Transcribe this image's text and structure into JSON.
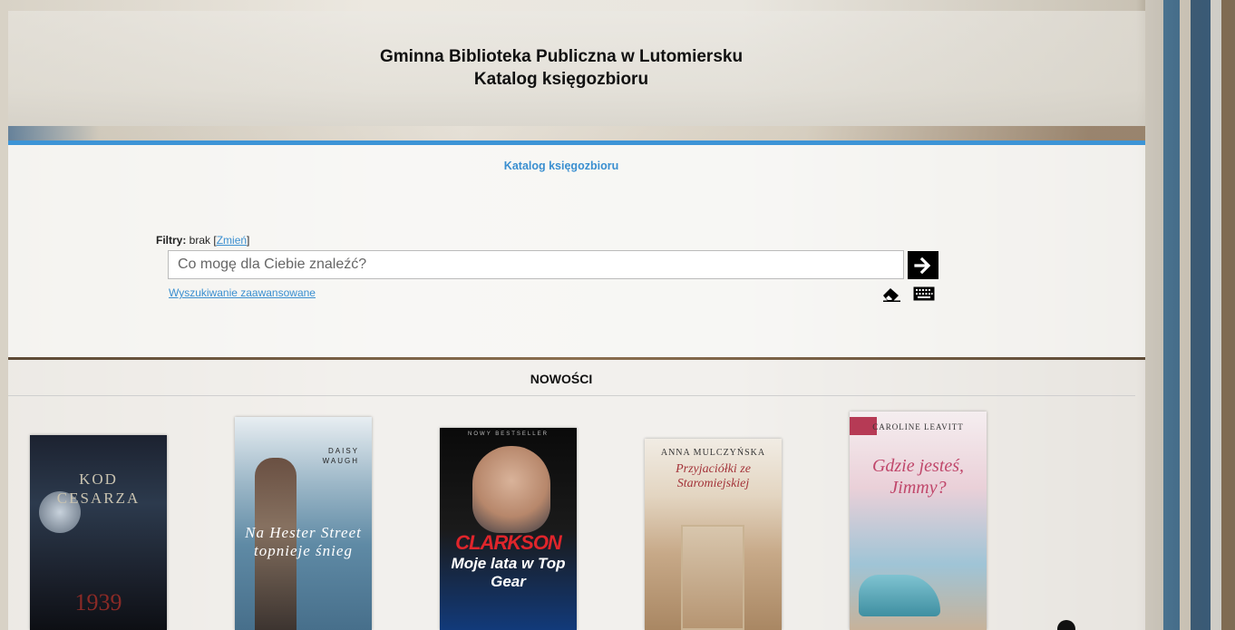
{
  "header": {
    "title_line1": "Gminna Biblioteka Publiczna w Lutomiersku",
    "title_line2": "Katalog księgozbioru"
  },
  "breadcrumb": "Katalog księgozbioru",
  "search": {
    "filters_label": "Filtry:",
    "filters_value": " brak ",
    "filters_change": "Zmień",
    "placeholder": "Co mogę dla Ciebie znaleźć?",
    "advanced_link": "Wyszukiwanie zaawansowane"
  },
  "news": {
    "heading": "NOWOŚCI",
    "books": [
      {
        "title_line1": "KOD",
        "title_line2": "CESARZA",
        "number": "1939"
      },
      {
        "author_line1": "DAISY",
        "author_line2": "WAUGH",
        "title": "Na Hester Street topnieje śnieg"
      },
      {
        "top": "NOWY BESTSELLER",
        "title": "CLARKSON",
        "subtitle": "Moje lata w Top Gear"
      },
      {
        "author": "ANNA MULCZYŃSKA",
        "title": "Przyjaciółki ze Staromiejskiej"
      },
      {
        "author": "CAROLINE LEAVITT",
        "title": "Gdzie jesteś, Jimmy?"
      }
    ]
  },
  "icons": {
    "go": "arrow-right-icon",
    "eraser": "eraser-icon",
    "keyboard": "keyboard-icon"
  },
  "colors": {
    "accent": "#3d94d6",
    "link": "#3a8fd0"
  }
}
